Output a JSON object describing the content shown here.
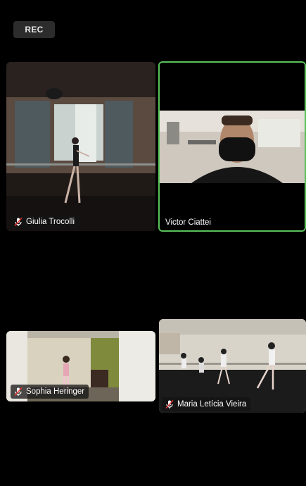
{
  "recording": {
    "label": "REC"
  },
  "participants": [
    {
      "name": "Giulia Trocolli",
      "muted": true,
      "active": false
    },
    {
      "name": "Victor Ciattei",
      "muted": false,
      "active": true
    },
    {
      "name": "Sophia Heringer",
      "muted": true,
      "active": false
    },
    {
      "name": "Maria Letícia Vieira",
      "muted": true,
      "active": false
    }
  ],
  "colors": {
    "active_border": "#5ac25a",
    "background": "#000000",
    "rec_bg": "#2c2c2c"
  },
  "icons": {
    "muted": "mic-muted-icon"
  }
}
